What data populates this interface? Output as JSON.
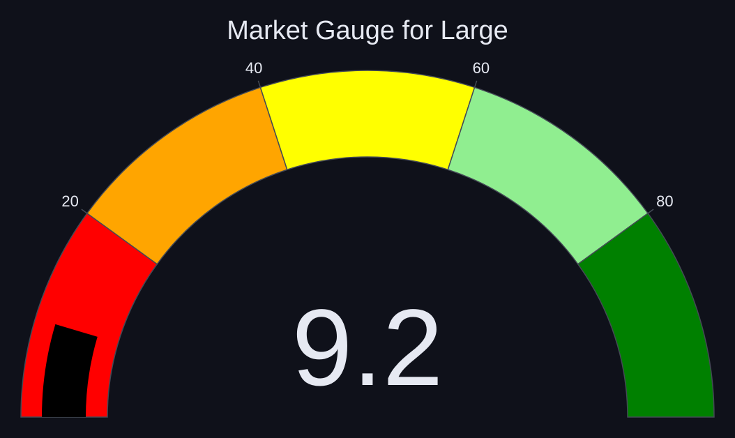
{
  "chart_data": {
    "type": "gauge",
    "title": "Market Gauge for Large",
    "value": 9.2,
    "value_label": "9.2",
    "range": [
      0,
      100
    ],
    "ticks": [
      {
        "value": 20,
        "label": "20"
      },
      {
        "value": 40,
        "label": "40"
      },
      {
        "value": 60,
        "label": "60"
      },
      {
        "value": 80,
        "label": "80"
      }
    ],
    "bands": [
      {
        "from": 0,
        "to": 20,
        "color": "#ff0000"
      },
      {
        "from": 20,
        "to": 40,
        "color": "#ffa500"
      },
      {
        "from": 40,
        "to": 60,
        "color": "#ffff00"
      },
      {
        "from": 60,
        "to": 80,
        "color": "#90ee90"
      },
      {
        "from": 80,
        "to": 100,
        "color": "#008000"
      }
    ],
    "bar_color": "#000000",
    "background_color": "#0f111a",
    "text_color": "#e6e9f2",
    "border_color": "#444a55"
  }
}
